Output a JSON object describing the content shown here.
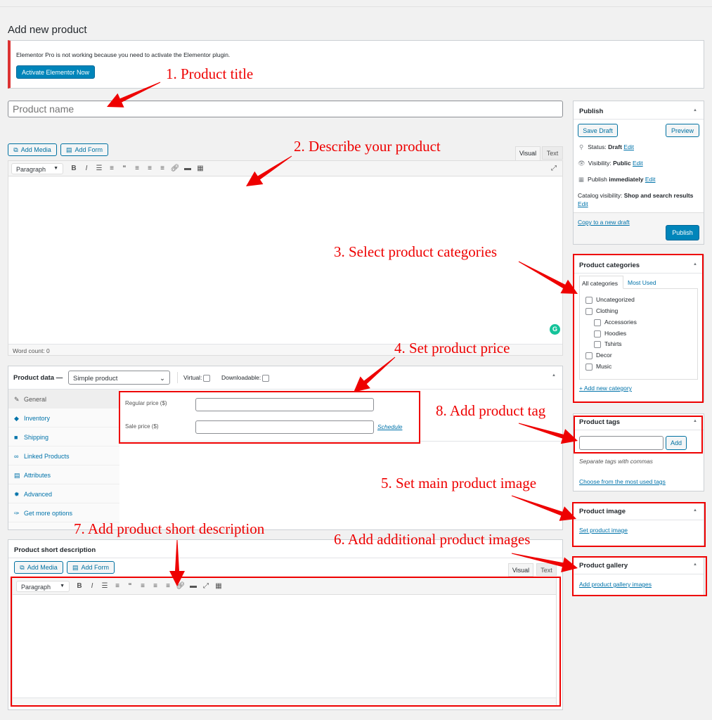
{
  "page_title": "Add new product",
  "notice": {
    "text": "Elementor Pro is not working because you need to activate the Elementor plugin.",
    "button": "Activate Elementor Now"
  },
  "title_input": {
    "placeholder": "Product name"
  },
  "editor": {
    "add_media": "Add Media",
    "add_form": "Add Form",
    "tab_visual": "Visual",
    "tab_text": "Text",
    "format": "Paragraph",
    "word_count": "Word count: 0",
    "grammarly": "G"
  },
  "product_data": {
    "label": "Product data —",
    "type": "Simple product",
    "virtual": "Virtual:",
    "downloadable": "Downloadable:",
    "tabs": [
      {
        "label": "General",
        "icon": "wrench"
      },
      {
        "label": "Inventory",
        "icon": "tag"
      },
      {
        "label": "Shipping",
        "icon": "truck"
      },
      {
        "label": "Linked Products",
        "icon": "link"
      },
      {
        "label": "Attributes",
        "icon": "list"
      },
      {
        "label": "Advanced",
        "icon": "gear"
      },
      {
        "label": "Get more options",
        "icon": "plugin"
      }
    ],
    "regular_price": "Regular price ($)",
    "sale_price": "Sale price ($)",
    "schedule": "Schedule"
  },
  "short_description": {
    "title": "Product short description",
    "add_media": "Add Media",
    "add_form": "Add Form",
    "tab_visual": "Visual",
    "tab_text": "Text",
    "format": "Paragraph"
  },
  "publish": {
    "title": "Publish",
    "save_draft": "Save Draft",
    "preview": "Preview",
    "status_label": "Status:",
    "status": "Draft",
    "visibility_label": "Visibility:",
    "visibility": "Public",
    "publish_label": "Publish",
    "publish_when": "immediately",
    "catalog_label": "Catalog visibility:",
    "catalog": "Shop and search results",
    "edit": "Edit",
    "copy": "Copy to a new draft",
    "publish_btn": "Publish"
  },
  "categories": {
    "title": "Product categories",
    "tab_all": "All categories",
    "tab_most": "Most Used",
    "items": [
      "Uncategorized",
      "Clothing",
      "Accessories",
      "Hoodies",
      "Tshirts",
      "Decor",
      "Music"
    ],
    "add": "+ Add new category"
  },
  "tags": {
    "title": "Product tags",
    "add": "Add",
    "hint": "Separate tags with commas",
    "choose": "Choose from the most used tags"
  },
  "image": {
    "title": "Product image",
    "set": "Set product image"
  },
  "gallery": {
    "title": "Product gallery",
    "add": "Add product gallery images"
  },
  "annotations": [
    "1. Product title",
    "2. Describe your product",
    "3. Select product categories",
    "4. Set product price",
    "5. Set main product image",
    "6. Add additional product images",
    "7. Add product short description",
    "8. Add product tag"
  ],
  "colors": {
    "annotation": "#e00000",
    "primary": "#0085ba",
    "link": "#0073aa",
    "notice_border": "#dc3232"
  }
}
